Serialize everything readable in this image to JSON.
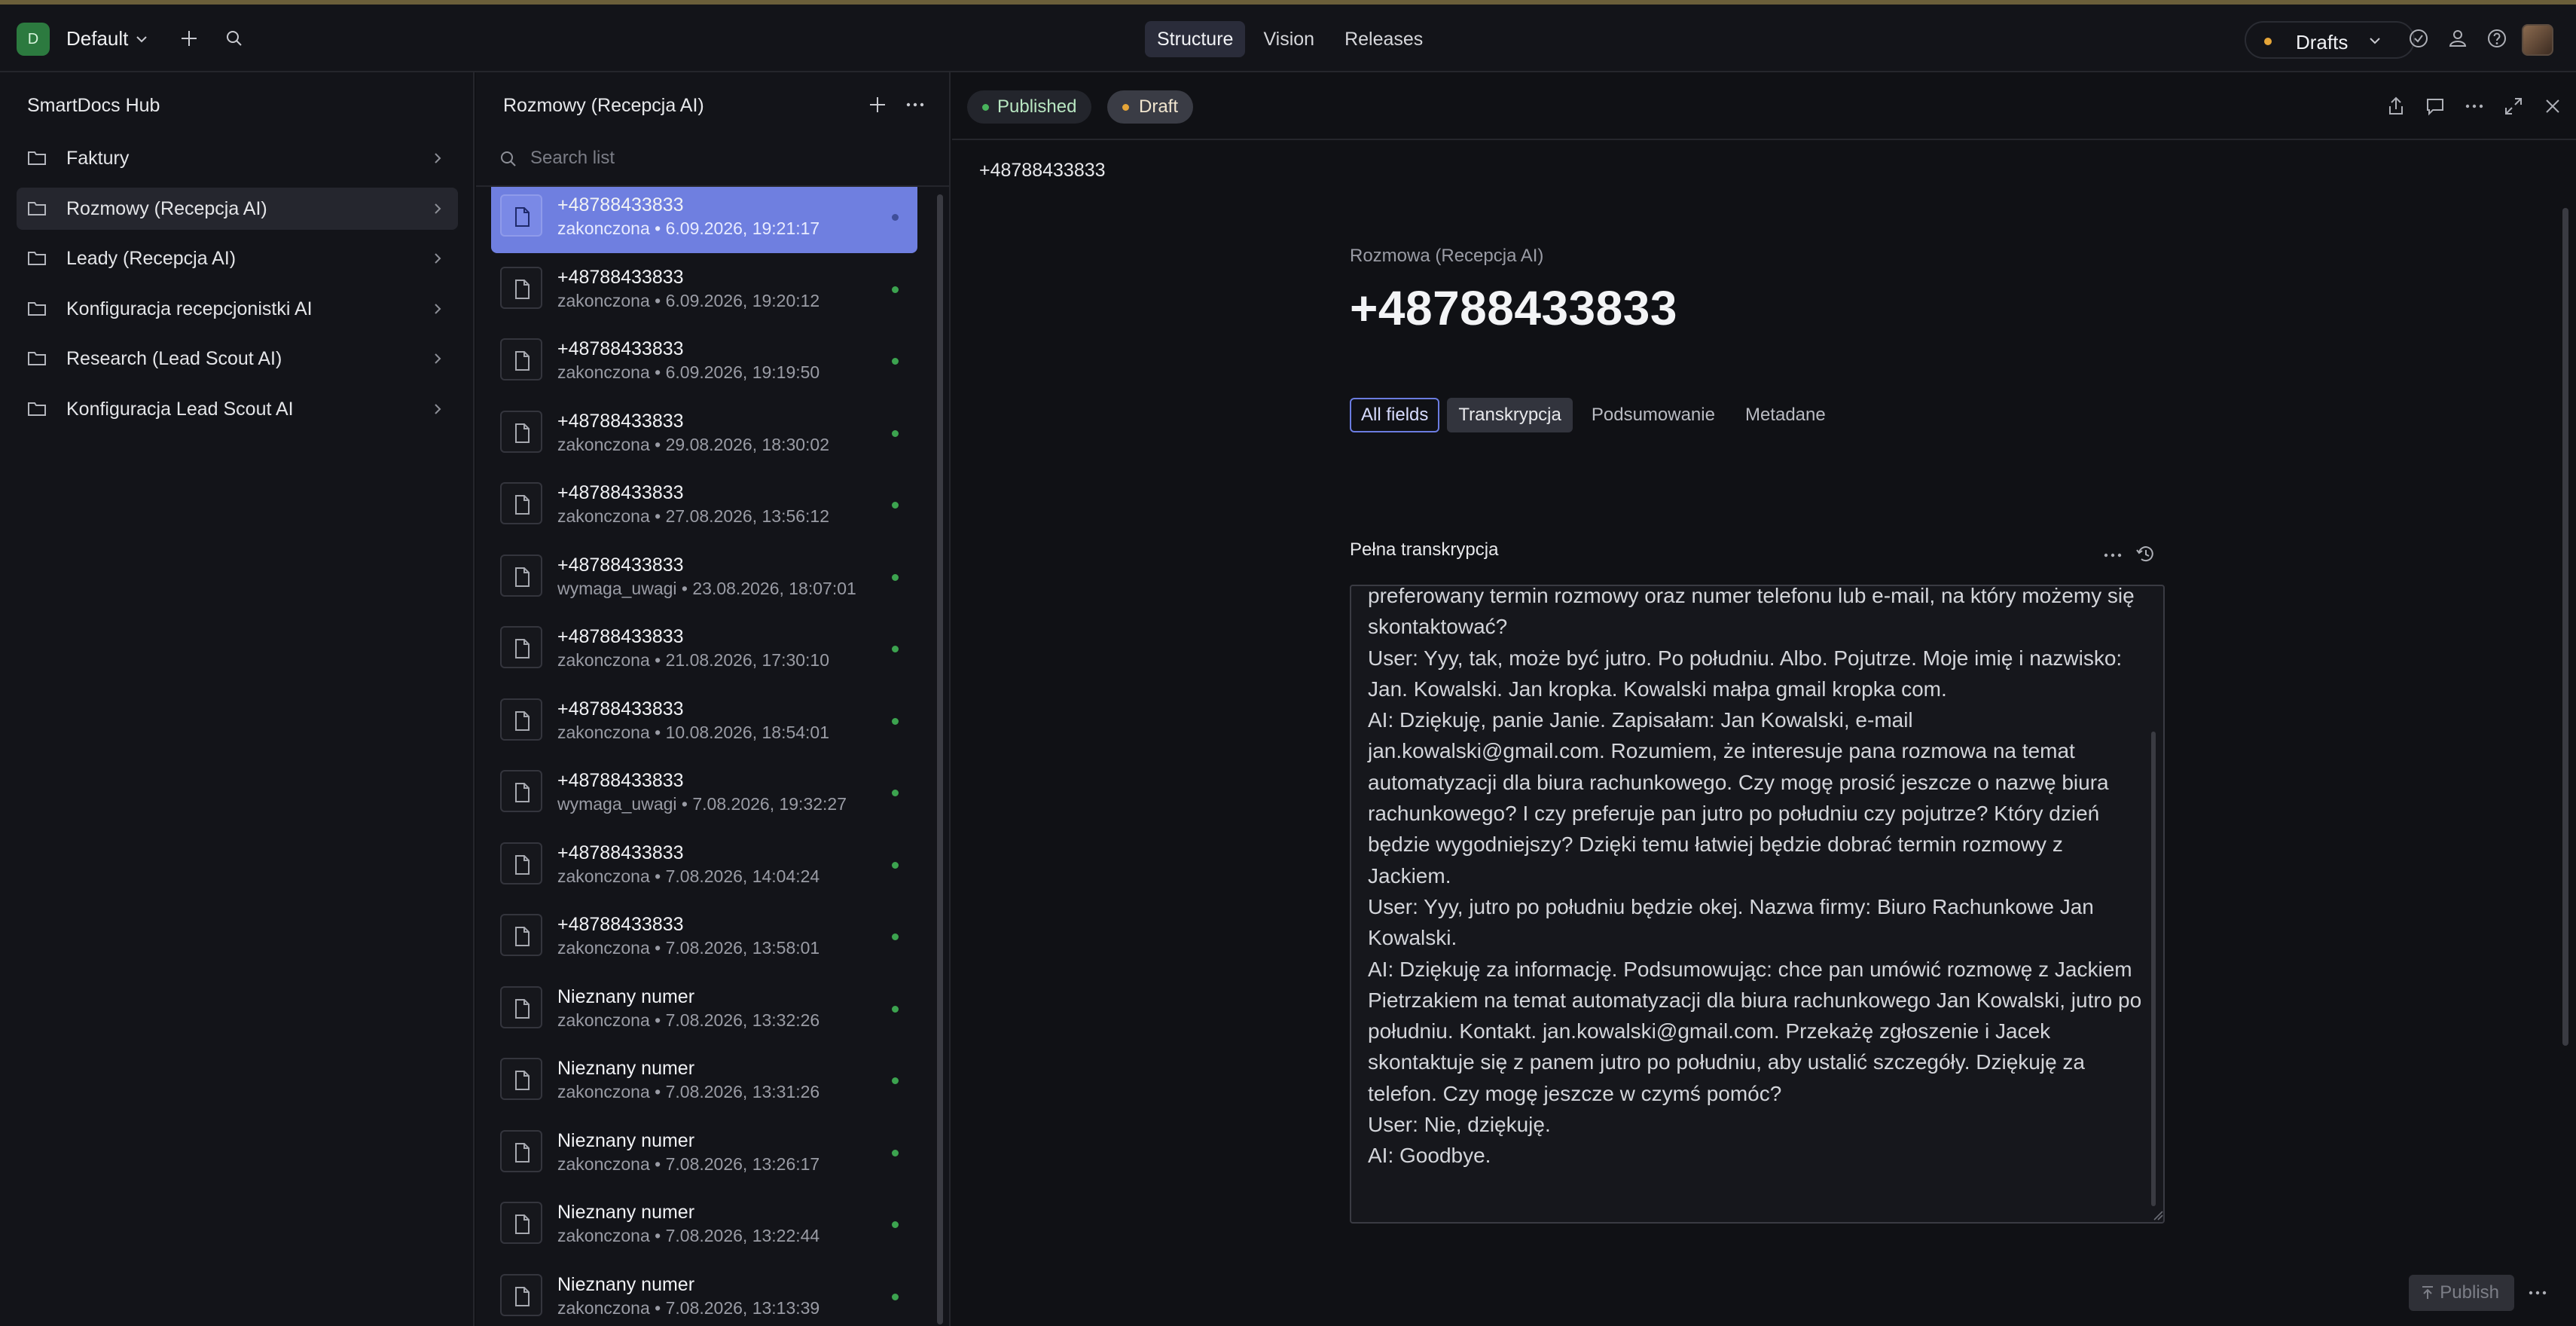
{
  "topbar": {
    "workspace_initial": "D",
    "workspace_name": "Default",
    "nav_tabs": [
      "Structure",
      "Vision",
      "Releases"
    ],
    "active_nav": "Structure",
    "drafts_label": "Drafts"
  },
  "sidebar": {
    "title": "SmartDocs Hub",
    "items": [
      {
        "label": "Faktury"
      },
      {
        "label": "Rozmowy (Recepcja AI)"
      },
      {
        "label": "Leady (Recepcja AI)"
      },
      {
        "label": "Konfiguracja recepcjonistki AI"
      },
      {
        "label": "Research (Lead Scout AI)"
      },
      {
        "label": "Konfiguracja Lead Scout AI"
      }
    ],
    "active_index": 1
  },
  "list": {
    "title": "Rozmowy (Recepcja AI)",
    "search_placeholder": "Search list",
    "rows": [
      {
        "title": "+48788433833",
        "status": "zakonczona",
        "date": "6.09.2026, 19:21:17"
      },
      {
        "title": "+48788433833",
        "status": "zakonczona",
        "date": "6.09.2026, 19:20:12"
      },
      {
        "title": "+48788433833",
        "status": "zakonczona",
        "date": "6.09.2026, 19:19:50"
      },
      {
        "title": "+48788433833",
        "status": "zakonczona",
        "date": "29.08.2026, 18:30:02"
      },
      {
        "title": "+48788433833",
        "status": "zakonczona",
        "date": "27.08.2026, 13:56:12"
      },
      {
        "title": "+48788433833",
        "status": "wymaga_uwagi",
        "date": "23.08.2026, 18:07:01"
      },
      {
        "title": "+48788433833",
        "status": "zakonczona",
        "date": "21.08.2026, 17:30:10"
      },
      {
        "title": "+48788433833",
        "status": "zakonczona",
        "date": "10.08.2026, 18:54:01"
      },
      {
        "title": "+48788433833",
        "status": "wymaga_uwagi",
        "date": "7.08.2026, 19:32:27"
      },
      {
        "title": "+48788433833",
        "status": "zakonczona",
        "date": "7.08.2026, 14:04:24"
      },
      {
        "title": "+48788433833",
        "status": "zakonczona",
        "date": "7.08.2026, 13:58:01"
      },
      {
        "title": "Nieznany numer",
        "status": "zakonczona",
        "date": "7.08.2026, 13:32:26"
      },
      {
        "title": "Nieznany numer",
        "status": "zakonczona",
        "date": "7.08.2026, 13:31:26"
      },
      {
        "title": "Nieznany numer",
        "status": "zakonczona",
        "date": "7.08.2026, 13:26:17"
      },
      {
        "title": "Nieznany numer",
        "status": "zakonczona",
        "date": "7.08.2026, 13:22:44"
      },
      {
        "title": "Nieznany numer",
        "status": "zakonczona",
        "date": "7.08.2026, 13:13:39"
      }
    ],
    "separator": " • "
  },
  "document": {
    "status_published": "Published",
    "status_draft": "Draft",
    "header_title": "+48788433833",
    "type_label": "Rozmowa (Recepcja AI)",
    "title": "+48788433833",
    "field_tabs": [
      "All fields",
      "Transkrypcja",
      "Podsumowanie",
      "Metadane"
    ],
    "field_label": "Pełna transkrypcja",
    "transcript": "preferowany termin rozmowy oraz numer telefonu lub e-mail, na który możemy się skontaktować?\nUser: Yyy, tak, może być jutro. Po południu. Albo. Pojutrze. Moje imię i nazwisko: Jan. Kowalski. Jan kropka. Kowalski małpa gmail kropka com.\nAI: Dziękuję, panie Janie. Zapisałam: Jan Kowalski, e-mail jan.kowalski@gmail.com. Rozumiem, że interesuje pana rozmowa na temat automatyzacji dla biura rachunkowego. Czy mogę prosić jeszcze o nazwę biura rachunkowego? I czy preferuje pan jutro po południu czy pojutrze? Który dzień będzie wygodniejszy? Dzięki temu łatwiej będzie dobrać termin rozmowy z Jackiem.\nUser: Yyy, jutro po południu będzie okej. Nazwa firmy: Biuro Rachunkowe Jan Kowalski.\nAI: Dziękuję za informację. Podsumowując: chce pan umówić rozmowę z Jackiem Pietrzakiem na temat automatyzacji dla biura rachunkowego Jan Kowalski, jutro po południu. Kontakt. jan.kowalski@gmail.com. Przekażę zgłoszenie i Jacek skontaktuje się z panem jutro po południu, aby ustalić szczegóły. Dziękuję za telefon. Czy mogę jeszcze w czymś pomóc?\nUser: Nie, dziękuję.\nAI: Goodbye.",
    "publish_label": "Publish"
  },
  "colors": {
    "background": "#101115",
    "accent": "#6f7fe0",
    "published_dot": "#48b35c",
    "draft_dot": "#e5a538"
  }
}
